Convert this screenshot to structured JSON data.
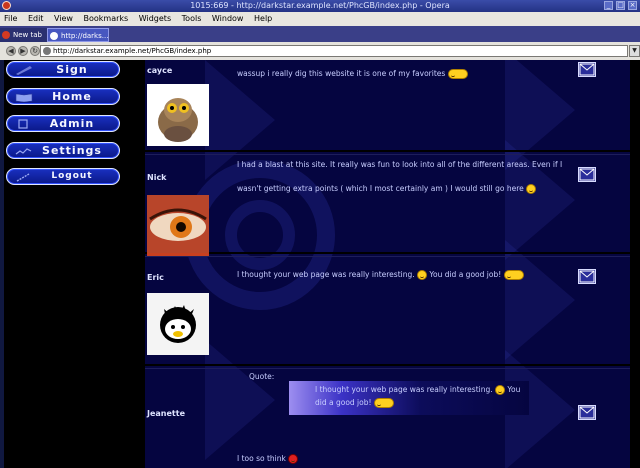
{
  "window": {
    "title": "1015:669 - http://darkstar.example.net/PhcGB/index.php - Opera",
    "controls": [
      "_",
      "□",
      "×"
    ]
  },
  "menu": [
    "File",
    "Edit",
    "View",
    "Bookmarks",
    "Widgets",
    "Tools",
    "Window",
    "Help"
  ],
  "tabs": [
    {
      "label": "New tab",
      "icon": "opera-icon"
    },
    {
      "label": "http://darks...",
      "icon": "page-icon"
    }
  ],
  "address": {
    "url": "http://darkstar.example.net/PhcGB/index.php",
    "buttons": [
      "back",
      "forward",
      "reload"
    ]
  },
  "sidebar": {
    "items": [
      {
        "label": "Sign",
        "icon": "pen-icon"
      },
      {
        "label": "Home",
        "icon": "book-icon"
      },
      {
        "label": "Admin",
        "icon": "gear-icon"
      },
      {
        "label": "Settings",
        "icon": "chart-icon"
      },
      {
        "label": "Logout",
        "icon": "door-icon"
      }
    ]
  },
  "posts": [
    {
      "author": "cayce",
      "message": "wassup i really dig this website it is one of my favorites",
      "avatar": "lemur-avatar"
    },
    {
      "author": "Nick",
      "message_line1": "I had a blast at this site. It really was fun to look into all of the different areas. Even if I",
      "message_line2": "wasn't getting extra points ( which I most certainly am ) I would still go here",
      "avatar": "eye-avatar"
    },
    {
      "author": "Eric",
      "message_a": "I thought your web page was really interesting.",
      "message_b": "You did a good job!",
      "avatar": "badtz-maru-avatar"
    },
    {
      "author": "Jeanette",
      "quote_label": "Quote:",
      "quote_a": "I thought your web page was really interesting.",
      "quote_b": "You",
      "quote_c": "did a good job!",
      "message": "I too so think"
    }
  ],
  "colors": {
    "content_bg": "#050540",
    "nav_button": "#1a30c0",
    "title_bar": "#2e3c94"
  }
}
